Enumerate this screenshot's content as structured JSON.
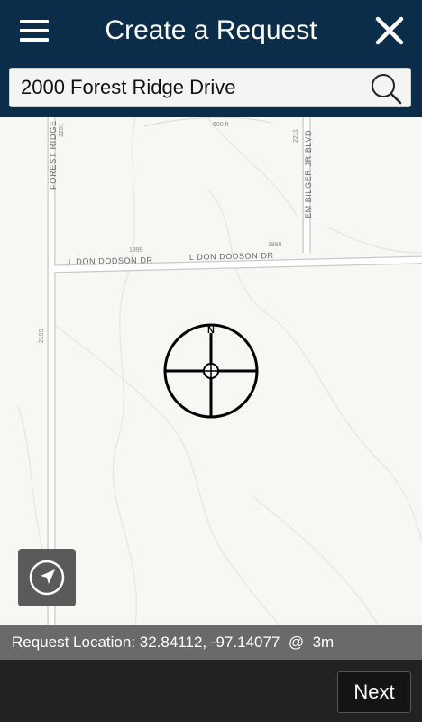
{
  "header": {
    "title": "Create a Request",
    "menu_icon": "hamburger-menu-icon",
    "close_icon": "close-icon"
  },
  "search": {
    "value": "2000 Forest Ridge Drive",
    "icon": "search-icon"
  },
  "map": {
    "streets": {
      "forest_ridge": "FOREST RIDGE",
      "don_dodson_left": "L DON DODSON DR",
      "don_dodson_right": "L DON DODSON DR",
      "em_bilger": "EM BILGER JR BLVD"
    },
    "numbers": {
      "n2201": "2201",
      "n2211": "2211",
      "n1899_left": "1899",
      "n1899_right": "1899",
      "n2199": "2199"
    },
    "contour_label": "600 ft",
    "compass_label": "N",
    "locate_icon": "navigation-arrow-icon"
  },
  "status": {
    "text": "Request Location: 32.84112, -97.14077  @  3m"
  },
  "footer": {
    "next_label": "Next"
  },
  "colors": {
    "header_bg": "#0c2d4a",
    "map_bg": "#f7f7f3",
    "status_bg": "#6a6a6a",
    "footer_bg": "#222222"
  }
}
